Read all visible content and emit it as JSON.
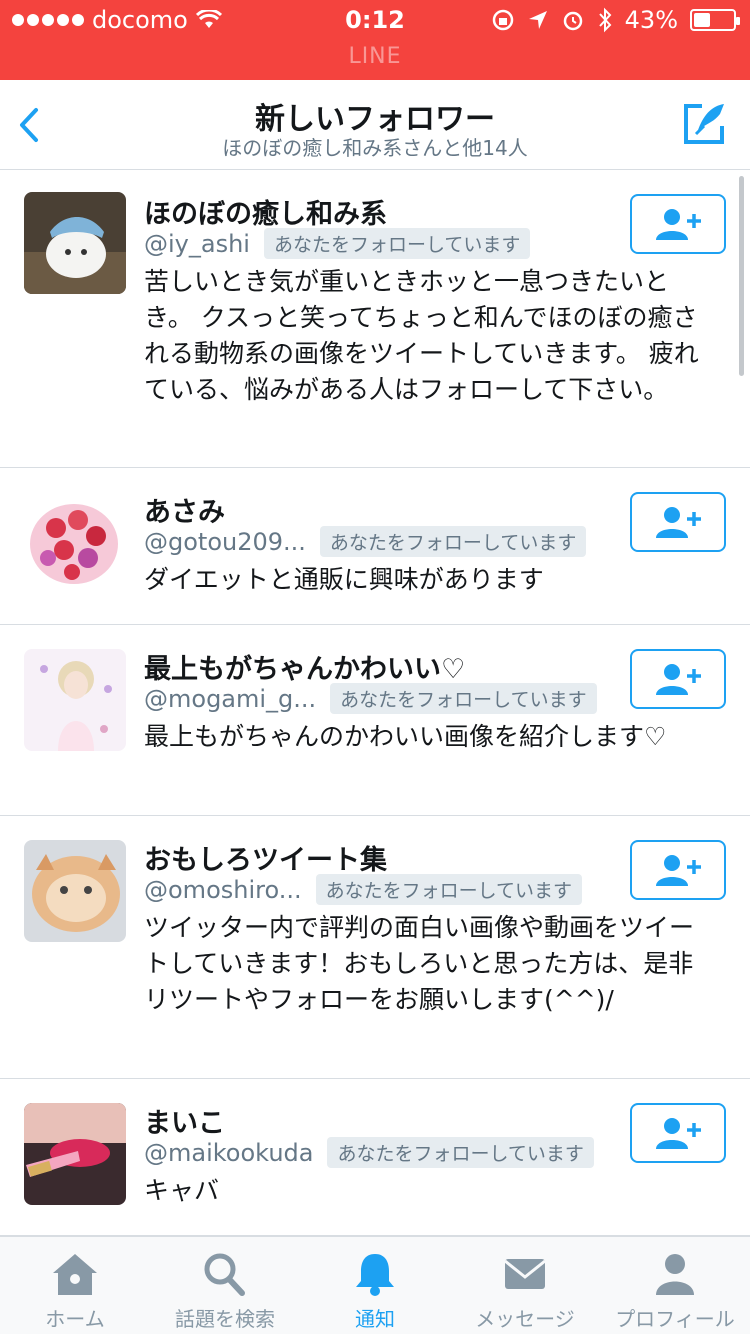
{
  "status_bar": {
    "carrier": "docomo",
    "time": "0:12",
    "battery": "43%",
    "battery_level": 0.43,
    "app_label": "LINE"
  },
  "header": {
    "title": "新しいフォロワー",
    "subtitle": "ほのぼの癒し和み系さんと他14人"
  },
  "followers": [
    {
      "name": "ほのぼの癒し和み系",
      "handle": "@iy_ashi",
      "badge": "あなたをフォローしています",
      "bio": "苦しいとき気が重いときホッと一息つきたいとき。 クスっと笑ってちょっと和んでほのぼの癒される動物系の画像をツイートしていきます。 疲れている、悩みがある人はフォローして下さい。"
    },
    {
      "name": "あさみ",
      "handle": "@gotou209...",
      "badge": "あなたをフォローしています",
      "bio": "ダイエットと通販に興味があります"
    },
    {
      "name": "最上もがちゃんかわいい♡",
      "handle": "@mogami_g...",
      "badge": "あなたをフォローしています",
      "bio": "最上もがちゃんのかわいい画像を紹介します♡"
    },
    {
      "name": "おもしろツイート集",
      "handle": "@omoshiro...",
      "badge": "あなたをフォローしています",
      "bio": "ツイッター内で評判の面白い画像や動画をツイートしていきます！おもしろいと思った方は、是非リツートやフォローをお願いします(^^)/"
    },
    {
      "name": "まいこ",
      "handle": "@maikookuda",
      "badge": "あなたをフォローしています",
      "bio": "キャバ"
    }
  ],
  "tabs": [
    {
      "label": "ホーム",
      "icon": "home-icon"
    },
    {
      "label": "話題を検索",
      "icon": "search-icon"
    },
    {
      "label": "通知",
      "icon": "bell-icon",
      "active": true
    },
    {
      "label": "メッセージ",
      "icon": "envelope-icon"
    },
    {
      "label": "プロフィール",
      "icon": "person-icon"
    }
  ],
  "colors": {
    "status_bar": "#f4433e",
    "accent": "#1da1f2",
    "muted": "#657786"
  }
}
